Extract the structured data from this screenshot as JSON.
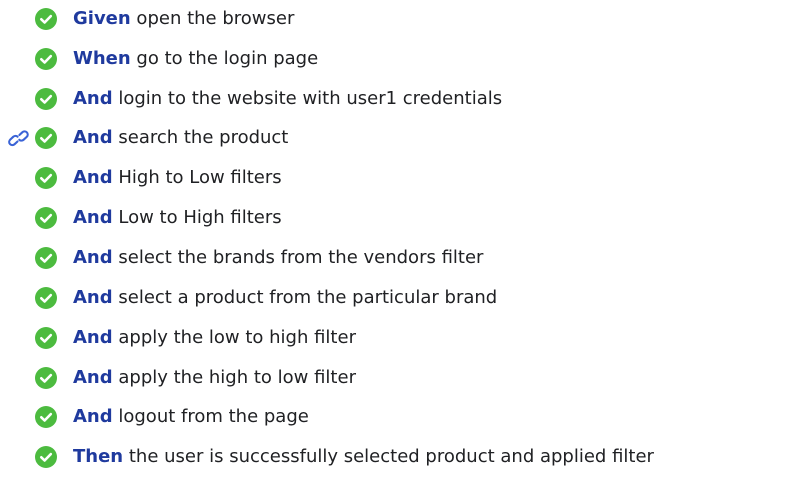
{
  "colors": {
    "keyword": "#1f3a9e",
    "text": "#202124",
    "passed": "#4cbb3f",
    "link": "#3a63d6"
  },
  "icons": {
    "status": "check-circle-icon",
    "permalink": "link-icon"
  },
  "steps": [
    {
      "keyword": "Given",
      "text": " open the browser",
      "status": "passed"
    },
    {
      "keyword": "When",
      "text": " go to the login page",
      "status": "passed"
    },
    {
      "keyword": "And",
      "text": " login to the website with user1 credentials",
      "status": "passed"
    },
    {
      "keyword": "And",
      "text": " search the product",
      "status": "passed",
      "has_link": true
    },
    {
      "keyword": "And",
      "text": " High to Low filters",
      "status": "passed"
    },
    {
      "keyword": "And",
      "text": " Low to High filters",
      "status": "passed"
    },
    {
      "keyword": "And",
      "text": " select the brands from the vendors filter",
      "status": "passed"
    },
    {
      "keyword": "And",
      "text": " select a product from the particular brand",
      "status": "passed"
    },
    {
      "keyword": "And",
      "text": " apply the low to high filter",
      "status": "passed"
    },
    {
      "keyword": "And",
      "text": " apply the high to low filter",
      "status": "passed"
    },
    {
      "keyword": "And",
      "text": " logout from the page",
      "status": "passed"
    },
    {
      "keyword": "Then",
      "text": " the user is successfully selected product and applied filter",
      "status": "passed"
    }
  ]
}
